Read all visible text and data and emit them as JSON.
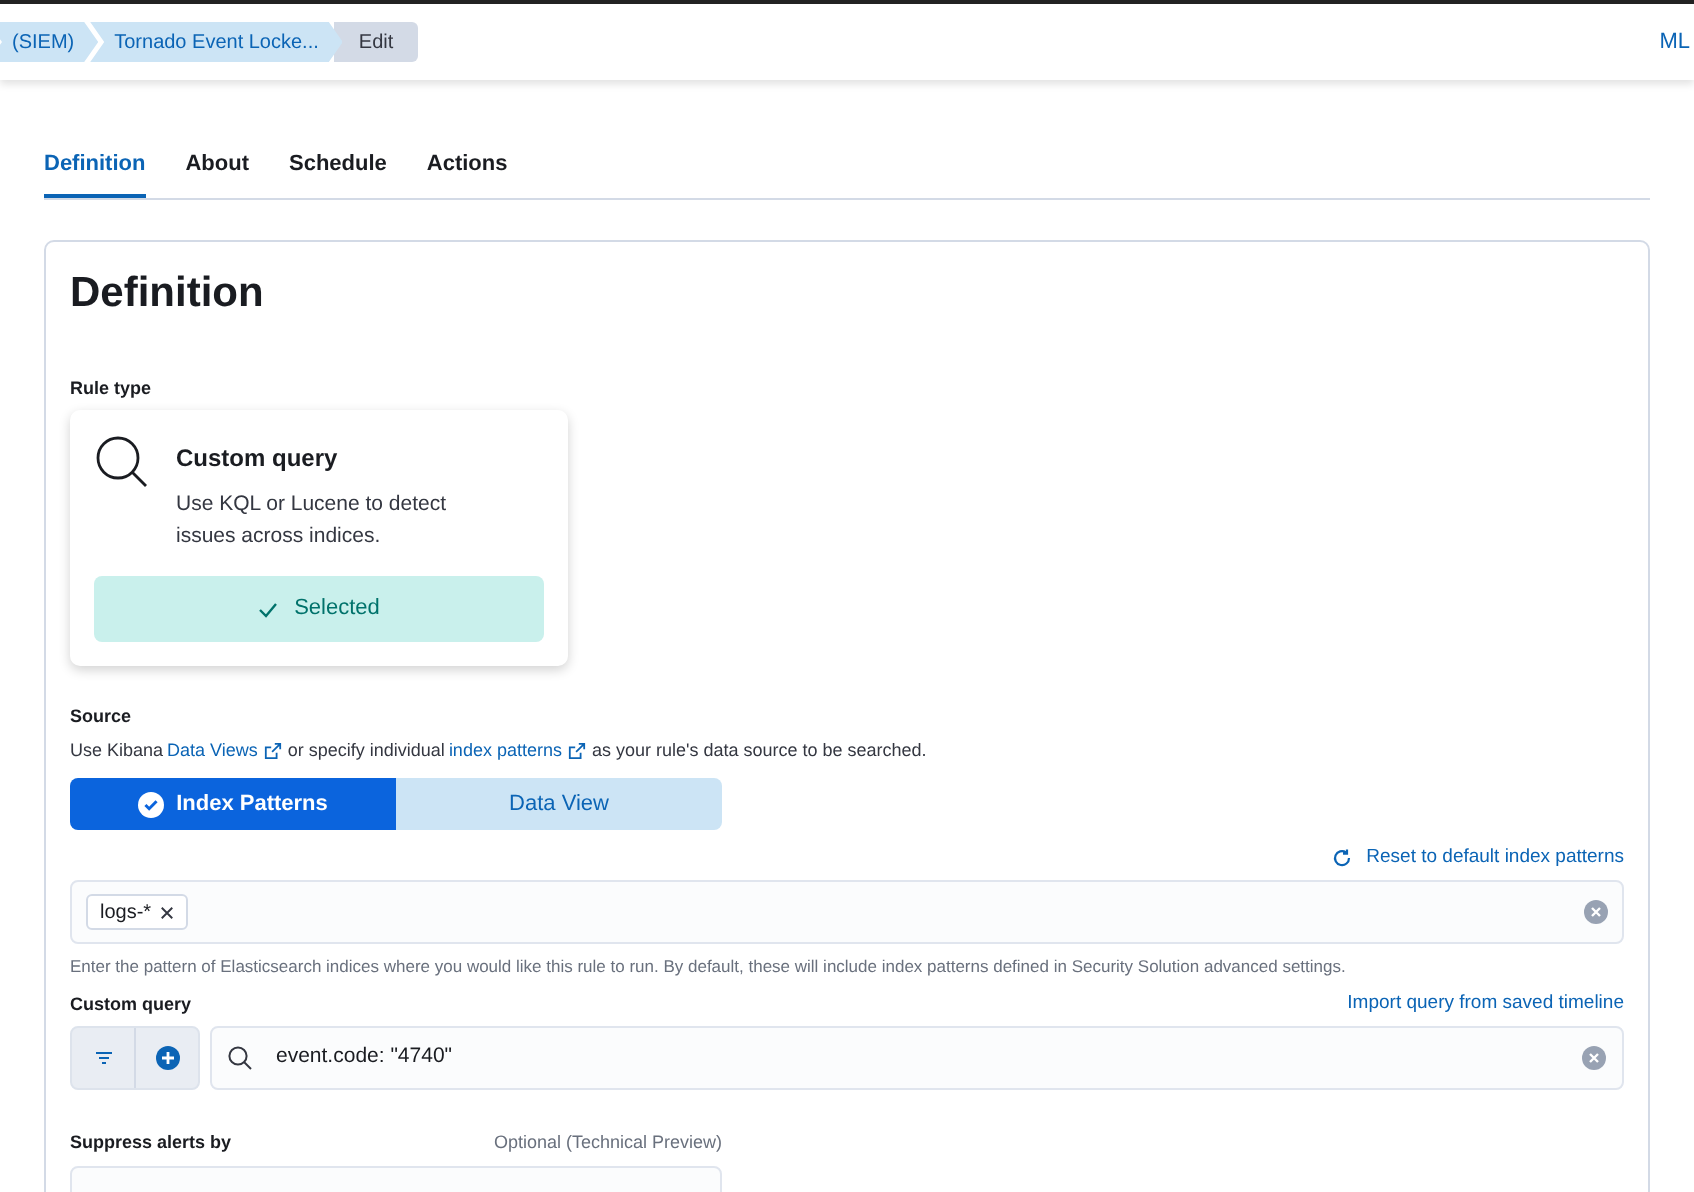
{
  "breadcrumbs": [
    {
      "label": "(SIEM)",
      "selected": false
    },
    {
      "label": "Tornado Event Locke...",
      "selected": false
    },
    {
      "label": "Edit",
      "selected": true
    }
  ],
  "header_link": "ML",
  "tabs": [
    {
      "label": "Definition",
      "selected": true
    },
    {
      "label": "About",
      "selected": false
    },
    {
      "label": "Schedule",
      "selected": false
    },
    {
      "label": "Actions",
      "selected": false
    }
  ],
  "panel": {
    "title": "Definition",
    "rule_type": {
      "label": "Rule type",
      "card": {
        "title": "Custom query",
        "description": "Use KQL or Lucene to detect issues across indices.",
        "button": "Selected",
        "selected": true
      }
    },
    "source": {
      "label": "Source",
      "help_parts": [
        "Use Kibana ",
        "Data Views",
        " or specify individual ",
        "index patterns",
        " as your rule's data source to be searched."
      ],
      "toggle": [
        {
          "label": "Index Patterns",
          "selected": true
        },
        {
          "label": "Data View",
          "selected": false
        }
      ],
      "reset_link": "Reset to default index patterns",
      "patterns": [
        "logs-*"
      ],
      "hint": "Enter the pattern of Elasticsearch indices where you would like this rule to run. By default, these will include index patterns defined in Security Solution advanced settings."
    },
    "custom_query": {
      "label": "Custom query",
      "import_link": "Import query from saved timeline",
      "value": "event.code: \"4740\""
    },
    "suppress": {
      "label": "Suppress alerts by",
      "optional": "Optional (Technical Preview)"
    }
  }
}
